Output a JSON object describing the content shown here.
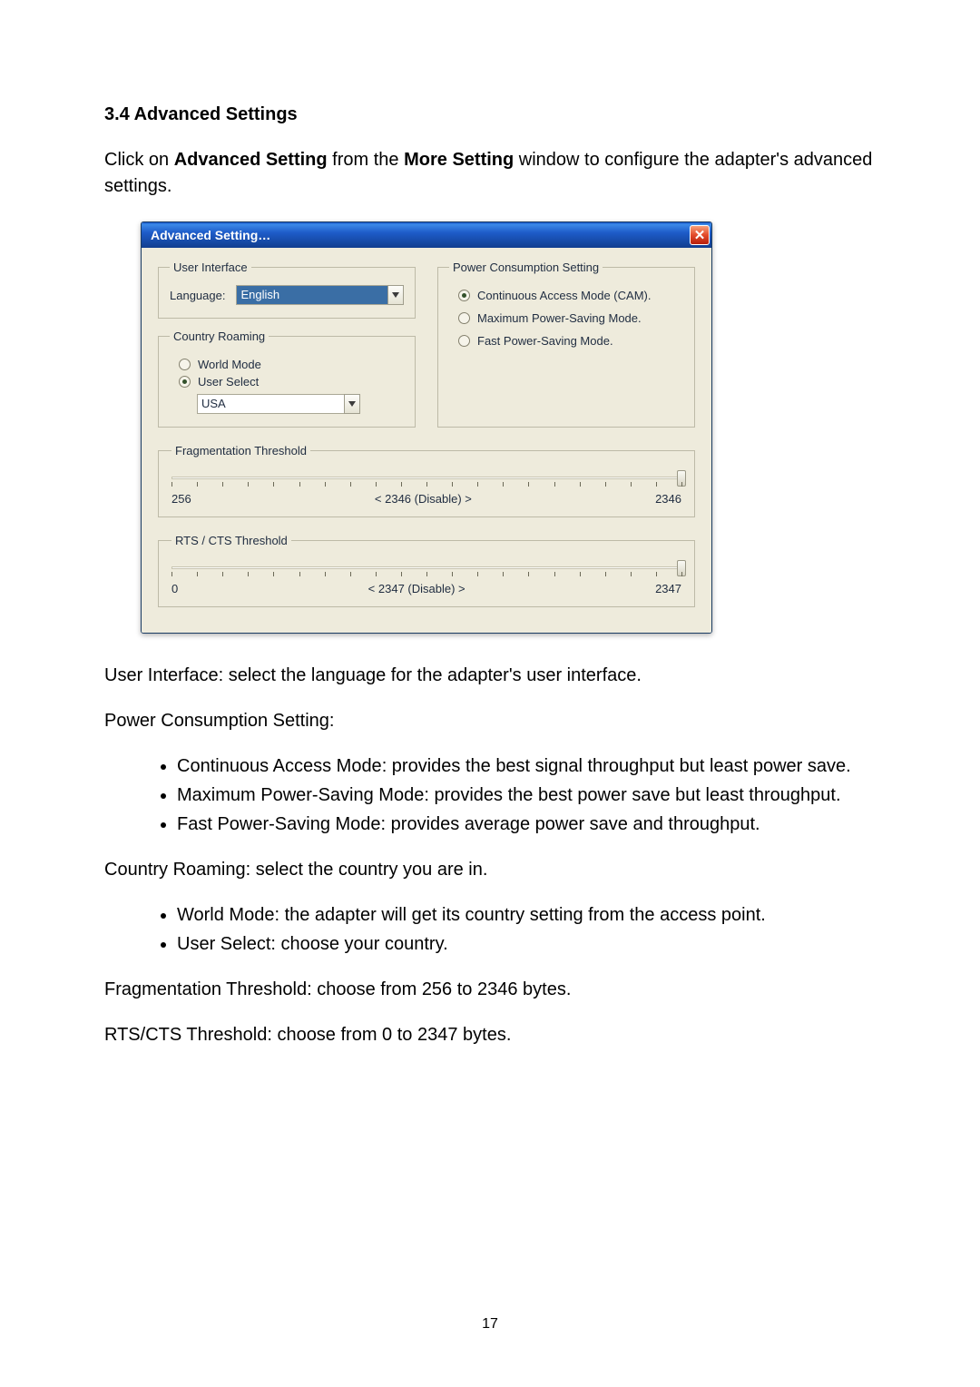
{
  "heading": "3.4 Advanced Settings",
  "intro": {
    "pre": "Click on ",
    "b1": "Advanced Setting",
    "mid": " from the ",
    "b2": "More Setting",
    "post": " window to configure the adapter's advanced settings."
  },
  "dialog": {
    "title": "Advanced Setting…",
    "ui_legend": "User Interface",
    "language_label": "Language:",
    "language_value": "English",
    "roaming_legend": "Country Roaming",
    "world_mode": "World Mode",
    "user_select": "User Select",
    "country_value": "USA",
    "power_legend": "Power Consumption Setting",
    "power_cam": "Continuous Access Mode (CAM).",
    "power_max": "Maximum Power-Saving Mode.",
    "power_fast": "Fast Power-Saving Mode.",
    "frag_legend": "Fragmentation Threshold",
    "frag_min": "256",
    "frag_center": "< 2346 (Disable) >",
    "frag_max": "2346",
    "rts_legend": "RTS / CTS Threshold",
    "rts_min": "0",
    "rts_center": "< 2347 (Disable) >",
    "rts_max": "2347"
  },
  "desc_ui": {
    "b": "User Interface",
    "t": ": select the language for the adapter's user interface."
  },
  "desc_power_head": "Power Consumption Setting",
  "desc_power_items": [
    {
      "b": "Continuous Access Mode",
      "t": ": provides the best signal throughput but least power save."
    },
    {
      "b": "Maximum Power-Saving Mode",
      "t": ": provides the best power save but least throughput."
    },
    {
      "b": "Fast Power-Saving Mode",
      "t": ": provides average power save and throughput."
    }
  ],
  "desc_roaming": {
    "b": "Country Roaming",
    "t": ": select the country you are in."
  },
  "desc_roaming_items": [
    {
      "b": "World Mode",
      "t": ": the adapter will get its country setting from the access point."
    },
    {
      "b": "User Select",
      "t": ": choose your country."
    }
  ],
  "desc_frag": {
    "b": "Fragmentation Threshold",
    "t": ": choose from 256 to 2346 bytes."
  },
  "desc_rts": {
    "b": "RTS/CTS Threshold",
    "t": ": choose from 0 to 2347 bytes."
  },
  "page_number": "17"
}
